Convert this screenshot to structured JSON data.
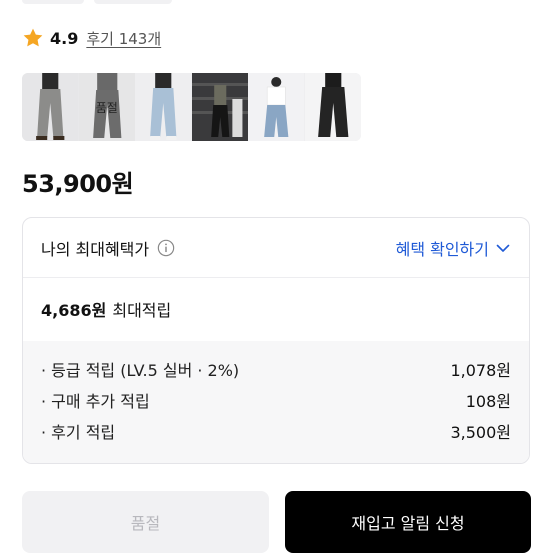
{
  "rating": {
    "value": "4.9",
    "review_link": "후기 143개",
    "star_color": "#f5a623"
  },
  "thumbnails": [
    {
      "name": "thumb-1",
      "soldout": false
    },
    {
      "name": "thumb-2",
      "soldout": true,
      "overlay": "품절"
    },
    {
      "name": "thumb-3",
      "soldout": false
    },
    {
      "name": "thumb-4",
      "soldout": false
    },
    {
      "name": "thumb-5",
      "soldout": false
    },
    {
      "name": "thumb-6",
      "soldout": false
    }
  ],
  "price": "53,900원",
  "benefit": {
    "title": "나의 최대혜택가",
    "toggle_label": "혜택 확인하기",
    "accent": "#1f5ad6",
    "max_amount": "4,686원",
    "max_label": "최대적립",
    "details": [
      {
        "label": "· 등급 적립 (LV.5 실버 · 2%)",
        "value": "1,078원"
      },
      {
        "label": "· 구매 추가 적립",
        "value": "108원"
      },
      {
        "label": "· 후기 적립",
        "value": "3,500원"
      }
    ]
  },
  "buttons": {
    "soldout_label": "품절",
    "restock_label": "재입고 알림 신청"
  }
}
